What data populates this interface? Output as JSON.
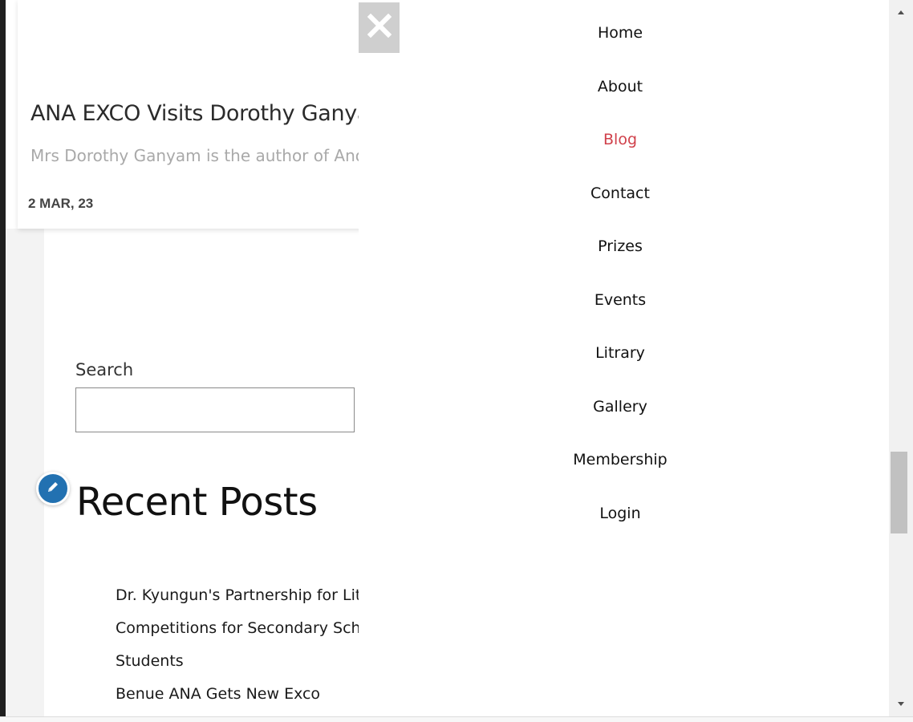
{
  "post": {
    "title": "ANA EXCO Visits Dorothy Ganyam",
    "excerpt": "Mrs Dorothy Ganyam is the author of Another",
    "date": "2 MAR, 23"
  },
  "search": {
    "label": "Search",
    "value": "",
    "placeholder": ""
  },
  "recent_posts": {
    "title": "Recent Posts",
    "items": [
      {
        "label": "Dr. Kyungun's Partnership for Literary"
      },
      {
        "label": "Competitions for Secondary School"
      },
      {
        "label": "Students"
      },
      {
        "label": "Benue ANA Gets New Exco"
      }
    ]
  },
  "nav": {
    "items": [
      {
        "label": "Home"
      },
      {
        "label": "About"
      },
      {
        "label": "Blog",
        "active": true
      },
      {
        "label": "Contact"
      },
      {
        "label": "Prizes"
      },
      {
        "label": "Events"
      },
      {
        "label": "Litrary"
      },
      {
        "label": "Gallery"
      },
      {
        "label": "Membership"
      },
      {
        "label": "Login"
      }
    ]
  },
  "icons": {
    "close": "close-icon",
    "edit": "pencil-icon",
    "scroll_up": "triangle-up-icon",
    "scroll_down": "triangle-down-icon"
  },
  "colors": {
    "active_nav": "#d0414b",
    "edit_button": "#2271b1",
    "close_button_bg": "#cfcfcf"
  }
}
